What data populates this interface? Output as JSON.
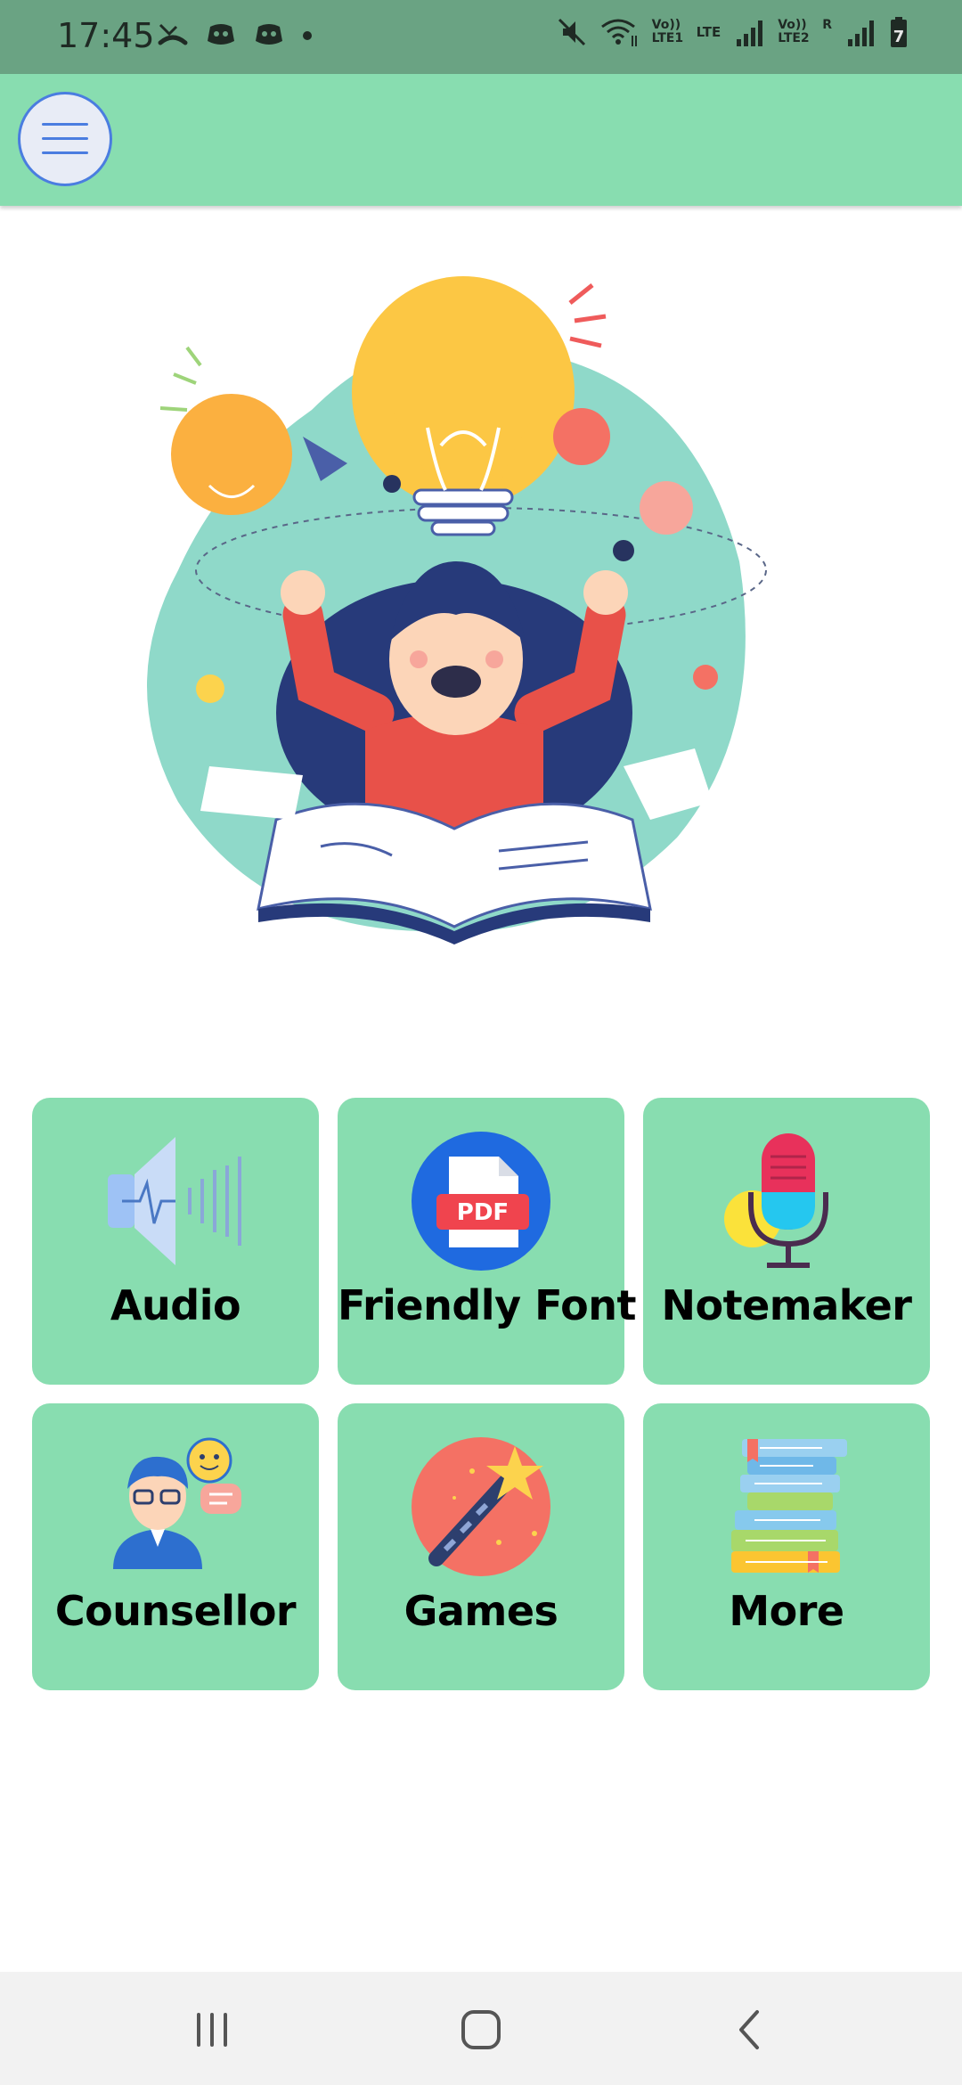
{
  "status_bar": {
    "time": "17:45",
    "left_icons": [
      "missed-call-icon",
      "discord-icon",
      "discord-icon",
      "dot-icon"
    ],
    "right_icons": [
      "mute-icon",
      "wifi-icon",
      "lte1-signal-icon",
      "lte2-signal-icon",
      "battery-icon"
    ],
    "sim1_label": "Vo)) LTE1",
    "sim2_label": "Vo)) LTE2",
    "lte_label": "LTE",
    "roaming_label": "R",
    "battery_level": "7"
  },
  "app_bar": {
    "menu_icon": "hamburger-menu-icon",
    "background_color": "#88ddb0"
  },
  "hero": {
    "illustration": "girl-reading-book-with-lightbulbs"
  },
  "tiles": [
    {
      "label": "Audio",
      "icon": "speaker-icon"
    },
    {
      "label": "Friendly Font",
      "icon": "pdf-icon"
    },
    {
      "label": "Notemaker",
      "icon": "microphone-icon"
    },
    {
      "label": "Counsellor",
      "icon": "counsellor-icon"
    },
    {
      "label": "Games",
      "icon": "magic-wand-icon"
    },
    {
      "label": "More",
      "icon": "books-stack-icon"
    }
  ],
  "nav_bar": {
    "buttons": [
      "recents-icon",
      "home-icon",
      "back-icon"
    ]
  },
  "colors": {
    "accent": "#88ddb0",
    "status_bar": "#6aa383",
    "tile": "#88ddb0"
  }
}
